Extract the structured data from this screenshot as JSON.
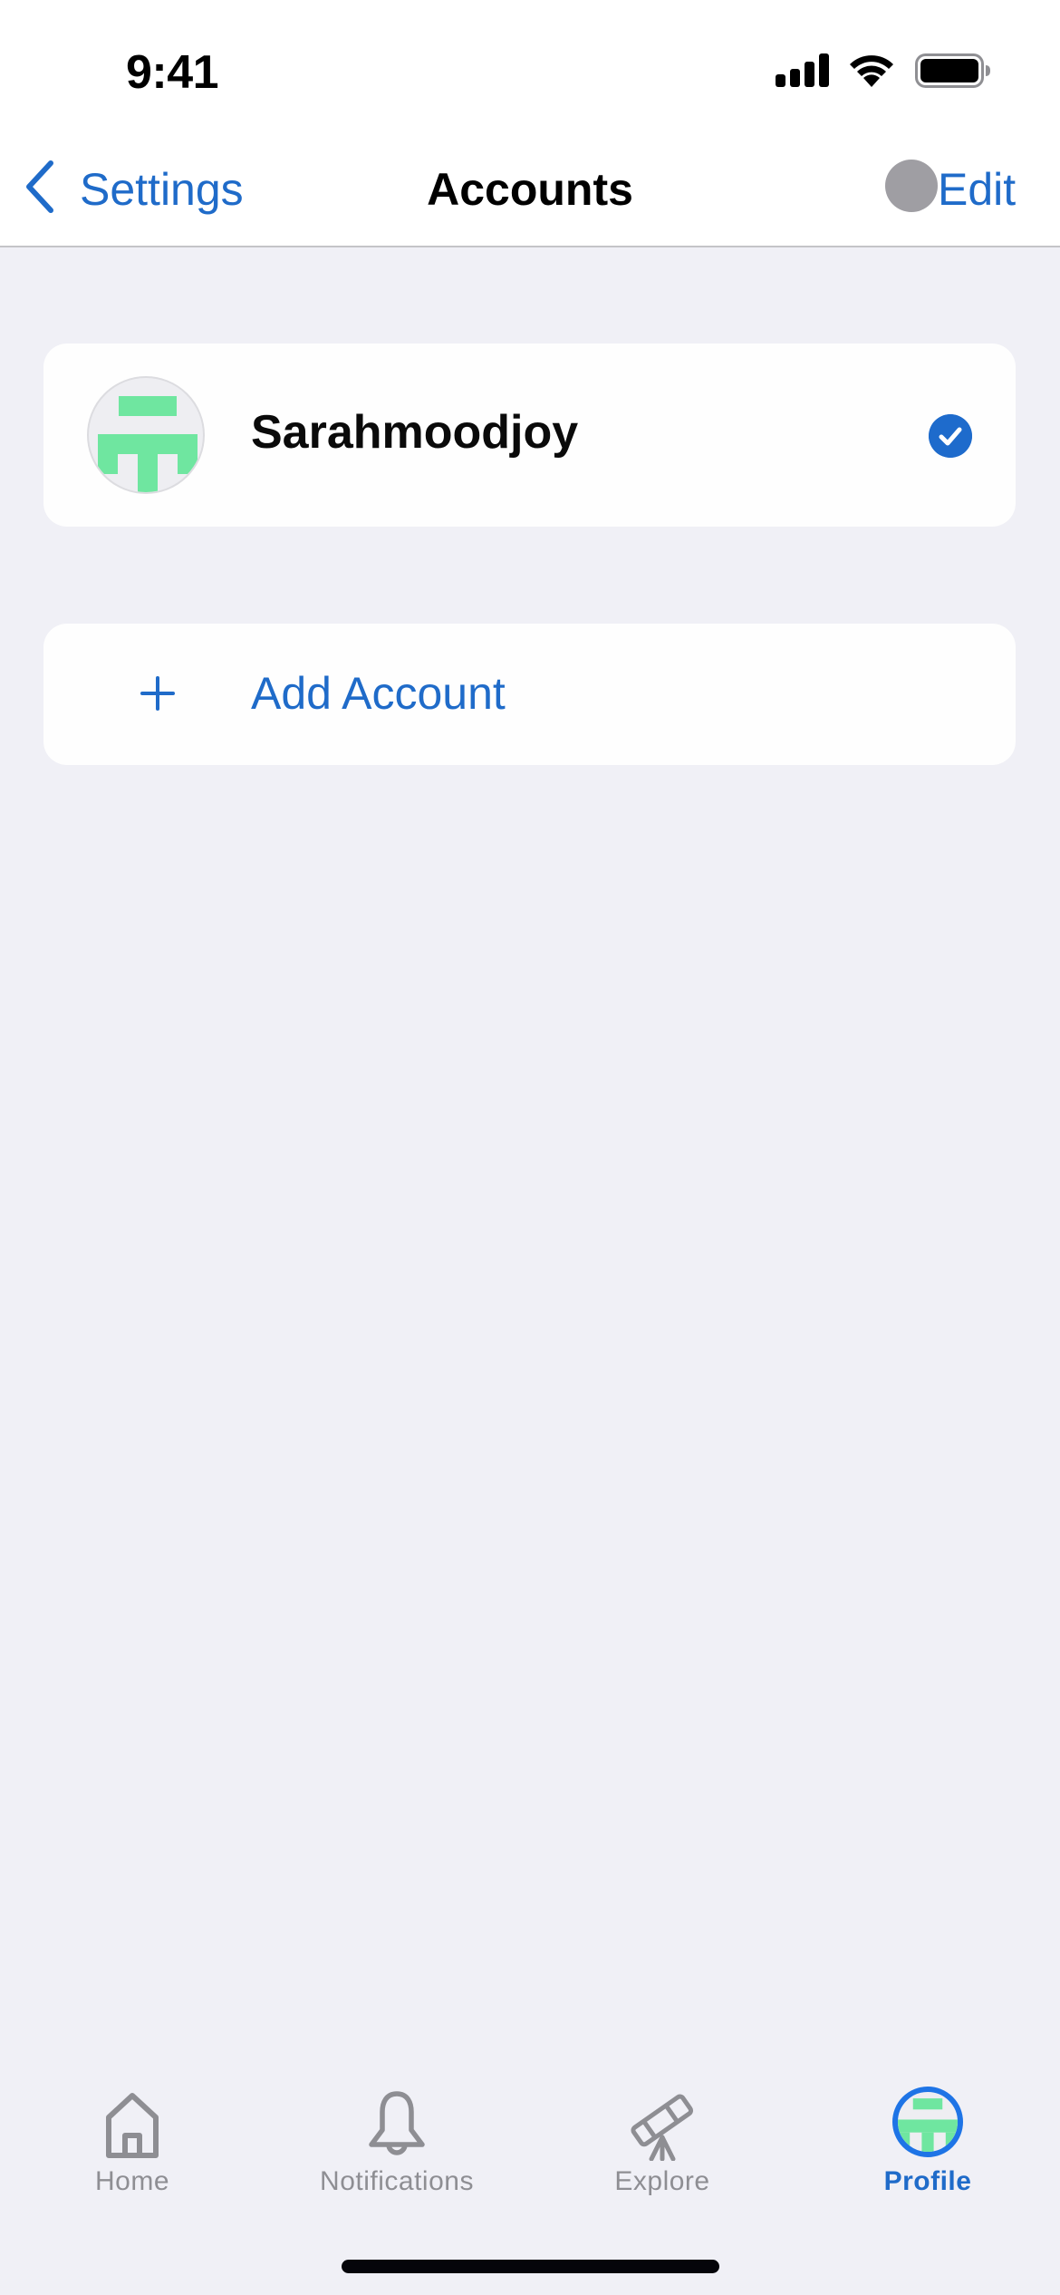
{
  "status_bar": {
    "time": "9:41",
    "icons": [
      "cellular-signal-icon",
      "wifi-icon",
      "battery-icon"
    ]
  },
  "nav": {
    "back_label": "Settings",
    "back_icon": "chevron-left-icon",
    "title": "Accounts",
    "edit_label": "Edit"
  },
  "accounts": [
    {
      "name": "Sarahmoodjoy",
      "avatar_icon": "identicon-avatar",
      "selected": true,
      "selected_icon": "checkmark-circle-icon"
    }
  ],
  "add_account": {
    "icon": "plus-icon",
    "label": "Add Account"
  },
  "tabbar": {
    "items": [
      {
        "label": "Home",
        "icon": "house-icon",
        "active": false
      },
      {
        "label": "Notifications",
        "icon": "bell-icon",
        "active": false
      },
      {
        "label": "Explore",
        "icon": "telescope-icon",
        "active": false
      },
      {
        "label": "Profile",
        "icon": "profile-avatar-icon",
        "active": true
      }
    ]
  },
  "colors": {
    "accent": "#1f6bc9",
    "background": "#f0f0f6",
    "card": "#fefefe",
    "identicon": "#6fe6a0",
    "inactive_tab": "#8e8e93",
    "edit_dot": "#9f9ea3"
  }
}
